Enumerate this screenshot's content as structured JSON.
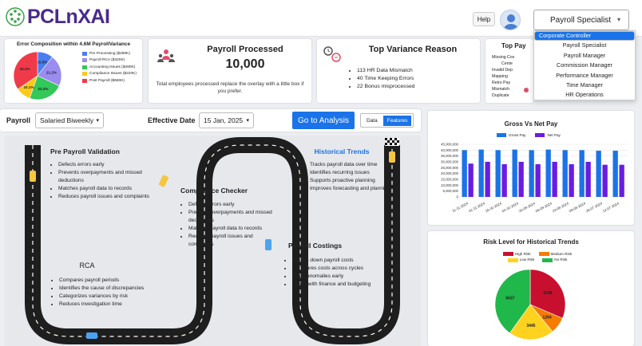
{
  "header": {
    "logo_text": "PCLnXAI",
    "help_label": "Help",
    "role_selected": "Payroll Specialist",
    "role_options": [
      "Corporate Controller",
      "Payroll Specialist",
      "Payroll Manager",
      "Commission Manager",
      "Performance Manager",
      "Time Manager",
      "HR Operations"
    ],
    "role_active_index": 0
  },
  "error_composition": {
    "title": "Error Composition within 4.6M PayrollVariance",
    "slices": [
      {
        "label": "Pre Processing ($290K)",
        "percent": "10.5%",
        "value": 10.5,
        "color": "#4a7df0"
      },
      {
        "label": "Payroll RCA ($420K)",
        "percent": "21.2%",
        "value": 21.2,
        "color": "#9b8cf0"
      },
      {
        "label": "Accounting Issues ($480K)",
        "percent": "23.2%",
        "value": 23.2,
        "color": "#34c759"
      },
      {
        "label": "Compliance Issues ($220K)",
        "percent": "10.1%",
        "value": 10.1,
        "color": "#ffc91a"
      },
      {
        "label": "Post Payroll ($660K)",
        "percent": "34.2%",
        "value": 34.2,
        "color": "#ef3a4a"
      }
    ]
  },
  "payroll_processed": {
    "title": "Payroll Processed",
    "value": "10,000",
    "desc": "Total employees processed replace the overlay with a little box if you prefer."
  },
  "top_variance": {
    "title": "Top Variance Reason",
    "items": [
      "113 HR Data Mismatch",
      "40 Time Keeping Errors",
      "22 Bonus misprocessed"
    ]
  },
  "top_pay_partial": {
    "title": "Top Pay",
    "lines": [
      "Missing Cos",
      "Cente",
      "Invalid Dep",
      "Mapping",
      "Retro Pay",
      "Mismatch",
      "Duplicate"
    ]
  },
  "filters": {
    "payroll_label": "Payroll",
    "payroll_value": "Salaried Biweekly",
    "date_label": "Effective Date",
    "date_value": "15 Jan, 2025",
    "go_button": "Go to Analysis",
    "toggle_data": "Data",
    "toggle_features": "Features"
  },
  "roadmap": {
    "pre_validation": {
      "title": "Pre Payroll Validation",
      "items": [
        "Defects errors early",
        "Prevents overpayments and missed deductions",
        "Matches payroll data to records",
        "Reduces payroll issues and complaints"
      ]
    },
    "compliance": {
      "title": "Compliance Checker",
      "items": [
        "Defects errors early",
        "Prevents overpayments and missed deductions",
        "Matches payroll data to records",
        "Reduces payroll issues and complaints"
      ]
    },
    "historical": {
      "title": "Historical Trends",
      "items": [
        "Tracks payroll data over time",
        "Identifies recurring issues",
        "Supports proactive planning",
        "Improves forecasting and planning"
      ]
    },
    "rca": {
      "title": "RCA",
      "items": [
        "Compares payroll periods",
        "Identifies the cause of discrepancies",
        "Categorizes variances by risk",
        "Reduces investigation time"
      ]
    },
    "costings": {
      "title": "Payroll Costings",
      "items": [
        "Breaks down payroll costs",
        "Compares costs across cycles",
        "Flags anomalies early",
        "Aligns with finance and budgeting"
      ]
    }
  },
  "chart_data": [
    {
      "type": "bar",
      "title": "Gross Vs Net Pay",
      "categories": [
        "11-11-2024",
        "01-11-2024",
        "16-10-2024",
        "04-10-2024",
        "20-09-2024",
        "06-09-2024",
        "23-08-2024",
        "09-08-2024",
        "26-07-2024",
        "12-07-2024"
      ],
      "series": [
        {
          "name": "Gross Pay",
          "color": "#1a73e8",
          "values": [
            40000000,
            40500000,
            40000000,
            40500000,
            40000000,
            40500000,
            40000000,
            40000000,
            39500000,
            39500000
          ]
        },
        {
          "name": "Net Pay",
          "color": "#6a1ce0",
          "values": [
            28500000,
            30000000,
            28000000,
            30000000,
            28000000,
            30000000,
            28000000,
            30000000,
            27500000,
            27500000
          ]
        }
      ],
      "ylim": [
        0,
        45000000
      ],
      "yticks": [
        "0",
        "5,000,000",
        "10,000,000",
        "15,000,000",
        "20,000,000",
        "25,000,000",
        "30,000,000",
        "35,000,000",
        "40,000,000",
        "45,000,000"
      ],
      "legend": "top"
    },
    {
      "type": "pie",
      "title": "Risk Level for Historical Trends",
      "slices": [
        {
          "name": "High Risk",
          "value": 5198,
          "color": "#c8102e"
        },
        {
          "name": "Medium Risk",
          "value": 1264,
          "color": "#f57c00"
        },
        {
          "name": "Low Risk",
          "value": 3445,
          "color": "#ffd21f"
        },
        {
          "name": "No Risk",
          "value": 6637,
          "color": "#20b84a"
        }
      ],
      "legend": "top"
    }
  ]
}
